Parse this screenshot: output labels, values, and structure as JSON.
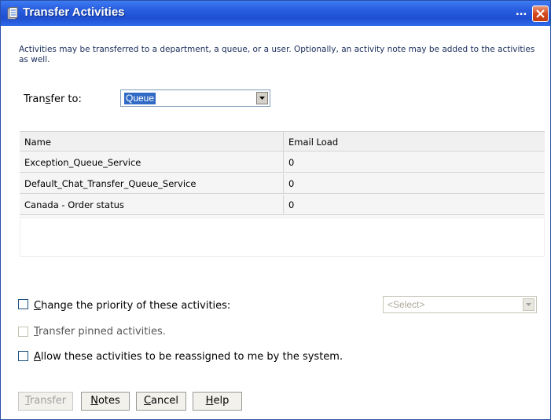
{
  "window": {
    "title": "Transfer Activities",
    "ellipsis": "...",
    "close_icon": "close-icon"
  },
  "description": "Activities may be transferred to a department, a queue, or a user. Optionally, an activity note may be added to the activities as well.",
  "transfer_to": {
    "label_pre": "Tran",
    "label_key": "s",
    "label_post": "fer to:",
    "selected": "Queue"
  },
  "table": {
    "columns": [
      "Name",
      "Email Load"
    ],
    "rows": [
      [
        "Exception_Queue_Service",
        "0"
      ],
      [
        "Default_Chat_Transfer_Queue_Service",
        "0"
      ],
      [
        "Canada  - Order status",
        "0"
      ]
    ]
  },
  "options": {
    "change_priority": {
      "key": "C",
      "rest": "hange the priority of these activities:",
      "checked": false
    },
    "priority_select": {
      "placeholder": "<Select>",
      "enabled": false
    },
    "transfer_pinned": {
      "key": "T",
      "rest": "ransfer pinned activities.",
      "checked": false,
      "enabled": false
    },
    "allow_reassign": {
      "key": "A",
      "rest": "llow these activities to be reassigned to me by the system.",
      "checked": false
    }
  },
  "buttons": {
    "transfer": {
      "key": "T",
      "rest": "ransfer",
      "enabled": false
    },
    "notes": {
      "key": "N",
      "rest": "otes",
      "enabled": true
    },
    "cancel": {
      "key": "C",
      "rest": "ancel",
      "enabled": true
    },
    "help": {
      "key": "H",
      "rest": "elp",
      "enabled": true
    }
  },
  "colors": {
    "title_bar": "#2a5ee0",
    "description_text": "#1a2d5a",
    "selection_highlight": "#316ac5"
  }
}
